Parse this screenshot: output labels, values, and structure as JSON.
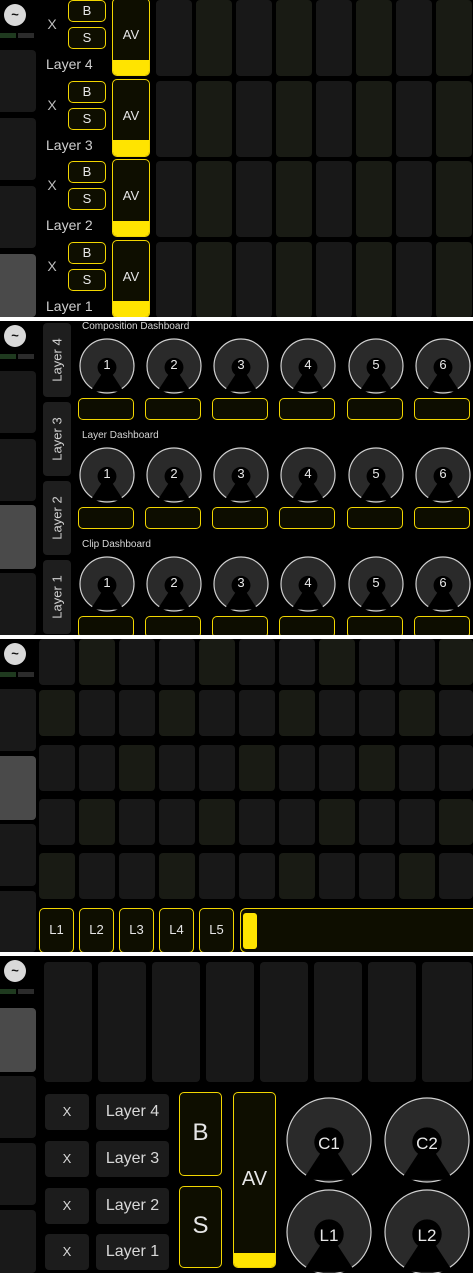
{
  "colors": {
    "accent": "#ffe400",
    "background": "#000000",
    "cell": "#181818"
  },
  "logo_icon": "resolume-logo-icon",
  "panel1": {
    "rows": [
      {
        "x": "X",
        "b": "B",
        "s": "S",
        "av": "AV",
        "label": "Layer 4",
        "level": 0.2
      },
      {
        "x": "X",
        "b": "B",
        "s": "S",
        "av": "AV",
        "label": "Layer 3",
        "level": 0.2
      },
      {
        "x": "X",
        "b": "B",
        "s": "S",
        "av": "AV",
        "label": "Layer 2",
        "level": 0.2
      },
      {
        "x": "X",
        "b": "B",
        "s": "S",
        "av": "AV",
        "label": "Layer 1",
        "level": 0.2
      }
    ]
  },
  "panel2": {
    "layer_tabs": [
      "Layer 4",
      "Layer 3",
      "Layer 2",
      "Layer 1"
    ],
    "sections": [
      {
        "title": "Composition Dashboard",
        "knobs": [
          "1",
          "2",
          "3",
          "4",
          "5",
          "6"
        ]
      },
      {
        "title": "Layer Dashboard",
        "knobs": [
          "1",
          "2",
          "3",
          "4",
          "5",
          "6"
        ]
      },
      {
        "title": "Clip Dashboard",
        "knobs": [
          "1",
          "2",
          "3",
          "4",
          "5",
          "6"
        ]
      }
    ]
  },
  "panel3": {
    "layer_buttons": [
      "L1",
      "L2",
      "L3",
      "L4",
      "L5"
    ],
    "crossfader_level": 0.02
  },
  "panel4": {
    "layers": [
      {
        "x": "X",
        "label": "Layer 4"
      },
      {
        "x": "X",
        "label": "Layer 3"
      },
      {
        "x": "X",
        "label": "Layer 2"
      },
      {
        "x": "X",
        "label": "Layer 1"
      }
    ],
    "b": "B",
    "s": "S",
    "av": "AV",
    "av_level": 0.08,
    "knobs": [
      "C1",
      "C2",
      "L1",
      "L2"
    ]
  }
}
